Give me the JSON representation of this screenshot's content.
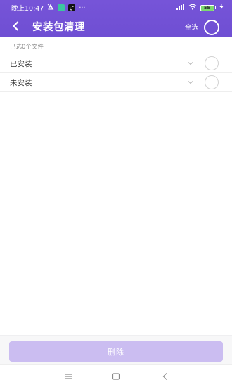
{
  "status_bar": {
    "time": "晚上10:47",
    "more": "···",
    "battery": "55"
  },
  "header": {
    "title": "安装包清理",
    "select_all": "全选"
  },
  "selection": {
    "count_text": "已选0个文件"
  },
  "groups": [
    {
      "label": "已安装"
    },
    {
      "label": "未安装"
    }
  ],
  "footer": {
    "delete_label": "删除"
  },
  "colors": {
    "primary": "#7352d6",
    "button_disabled": "#cbbdf1"
  }
}
